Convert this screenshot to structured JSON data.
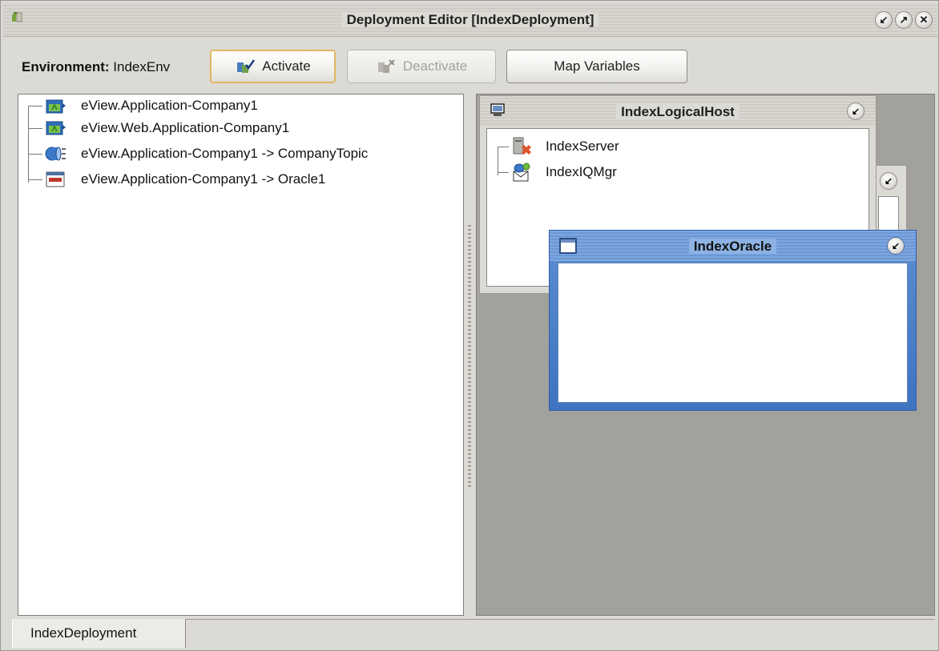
{
  "window": {
    "title": "Deployment Editor [IndexDeployment]",
    "app_icon": "deployment-icon",
    "controls": {
      "restore": "↙",
      "maximize": "↗",
      "close": "✕"
    }
  },
  "toolbar": {
    "environment_label": "Environment:",
    "environment_value": "IndexEnv",
    "activate_label": "Activate",
    "deactivate_label": "Deactivate",
    "map_variables_label": "Map Variables"
  },
  "tree": {
    "items": [
      {
        "label": "eView.Application-Company1",
        "icon": "application-icon"
      },
      {
        "label": "eView.Web.Application-Company1",
        "icon": "web-application-icon"
      },
      {
        "label": "eView.Application-Company1 -> CompanyTopic",
        "icon": "topic-icon"
      },
      {
        "label": "eView.Application-Company1 -> Oracle1",
        "icon": "oracle-icon"
      }
    ]
  },
  "canvas": {
    "logical_host": {
      "title": "IndexLogicalHost",
      "items": [
        {
          "label": "IndexServer",
          "icon": "server-icon"
        },
        {
          "label": "IndexIQMgr",
          "icon": "iq-manager-icon"
        }
      ],
      "button": "↙"
    },
    "oracle": {
      "title": "IndexOracle",
      "button": "↙"
    },
    "mini_button": "↙"
  },
  "tabs": [
    {
      "label": "IndexDeployment"
    }
  ],
  "colors": {
    "oracle_window_accent": "#3e74c0",
    "canvas_background": "#a3a19b",
    "focus_border": "#e0b860"
  }
}
